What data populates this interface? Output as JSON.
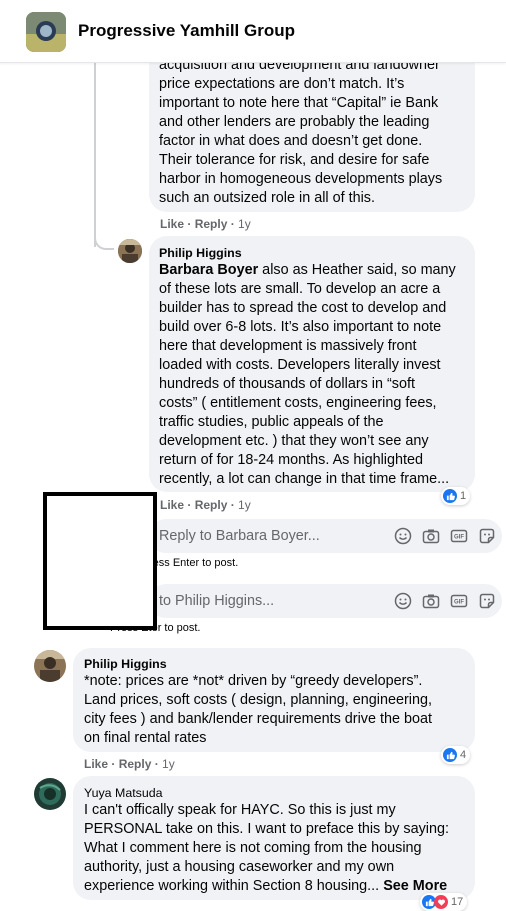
{
  "header": {
    "group_name": "Progressive Yamhill Group"
  },
  "comments": [
    {
      "id": "c1",
      "lines": [
        "acquisition and development and landowner",
        "price expectations are don’t match. It’s",
        "important to note here that “Capital” ie Bank",
        "and other lenders are probably the leading",
        "factor in what does and doesn’t get done.",
        "Their tolerance for risk, and desire for safe",
        "harbor in homogeneous developments plays",
        "such an outsized role in all of this."
      ],
      "like_label": "Like",
      "reply_label": "Reply",
      "time": "1y"
    },
    {
      "id": "c2",
      "author": "Philip Higgins",
      "mention": "Barbara Boyer",
      "first_line_rest": " also as Heather said, so many",
      "lines": [
        "of these lots are small. To develop an acre a",
        "builder has to spread the cost to develop and",
        "build over 6-8 lots. It’s also important to note",
        "here that development is massively front",
        "loaded with costs. Developers literally invest",
        "hundreds of thousands of dollars in “soft",
        "costs” ( entitlement costs, engineering fees,",
        "traffic studies, public appeals of the",
        "development etc. ) that they won’t see any",
        "return of for 18-24 months. As highlighted",
        "recently, a lot can change in that time frame..."
      ],
      "like_label": "Like",
      "reply_label": "Reply",
      "time": "1y",
      "reaction_count": "1"
    },
    {
      "id": "c3",
      "author": "Philip Higgins",
      "lines": [
        "*note: prices are *not* driven by “greedy developers”.",
        "Land prices, soft costs ( design, planning, engineering,",
        "city fees ) and bank/lender requirements drive the boat",
        "on final rental rates"
      ],
      "like_label": "Like",
      "reply_label": "Reply",
      "time": "1y",
      "reaction_count": "4"
    },
    {
      "id": "c4",
      "author": "Yuya Matsuda",
      "lines": [
        "I can't offically speak for HAYC. So this is just my",
        "PERSONAL take on this. I want to preface this by saying:",
        "What I comment here is not coming from the housing",
        "authority, just a housing caseworker and my own",
        "experience working within Section 8 housing..."
      ],
      "see_more": "See More",
      "reaction_count": "17"
    }
  ],
  "reply_boxes": [
    {
      "placeholder": "Reply to Barbara Boyer...",
      "hint": "ress Enter to post."
    },
    {
      "placeholder": "to Philip Higgins...",
      "hint_pre": "Press E",
      "hint_post": "ter to post."
    }
  ],
  "icons": [
    "emoji-icon",
    "camera-icon",
    "gif-icon",
    "sticker-icon",
    "like-reaction-icon",
    "love-reaction-icon"
  ],
  "colors": {
    "link_blue": "#1877f2",
    "bubble_gray": "#f0f2f5",
    "meta_gray": "#65676b"
  }
}
